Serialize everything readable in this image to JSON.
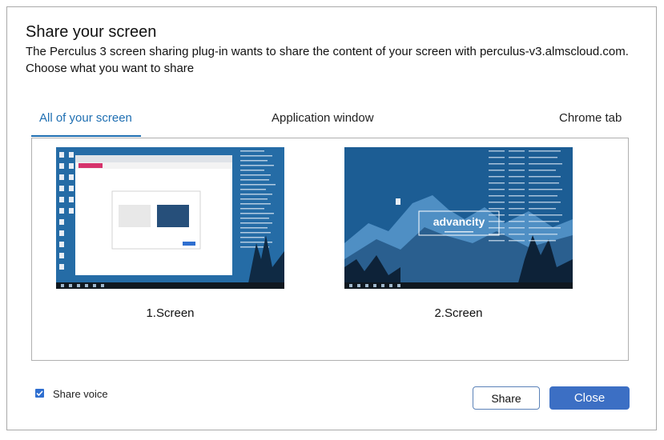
{
  "dialog": {
    "title": "Share your screen",
    "description_line1": "The Perculus 3 screen sharing plug-in wants to share the content of your screen with perculus-v3.almscloud.com.",
    "description_line2": "Choose what you want to share"
  },
  "tabs": [
    {
      "label": "All of your screen",
      "active": true
    },
    {
      "label": "Application window",
      "active": false
    },
    {
      "label": "Chrome tab",
      "active": false
    }
  ],
  "screens": [
    {
      "label": "1.Screen"
    },
    {
      "label": "2.Screen"
    }
  ],
  "preview2_logo_text": "advancity",
  "share_voice": {
    "label": "Share voice",
    "checked": true
  },
  "buttons": {
    "share": "Share",
    "close": "Close"
  },
  "colors": {
    "accent": "#1f6fb2",
    "close_button": "#3c6fc4",
    "checkbox": "#2f6fd0"
  }
}
